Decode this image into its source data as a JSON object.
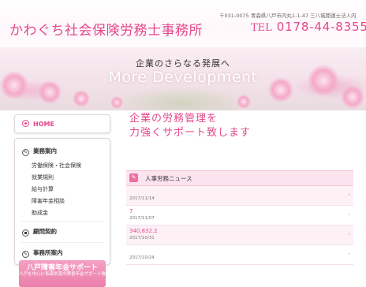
{
  "header": {
    "title": "かわぐち社会保険労務士事務所",
    "address": "〒031-0075 青森県八戸市内丸1-1-47 三八城開運士法人内",
    "tel_label": "TEL",
    "tel_number": "0178-44-8355"
  },
  "hero": {
    "tagline": "企業のさらなる発展へ",
    "english": "More Development"
  },
  "sidebar": {
    "home": "HOME",
    "groups": [
      {
        "icon": "pencil-icon",
        "label": "業務案内",
        "items": [
          "労働保険・社会保険",
          "就業規則",
          "給与計算",
          "障害年金相談",
          "助成金"
        ]
      },
      {
        "icon": "doc-icon",
        "label": "顧問契約",
        "items": []
      },
      {
        "icon": "pencil-icon",
        "label": "事務所案内",
        "items": []
      }
    ],
    "banner": {
      "title": "八戸障害年金サポート",
      "subtitle": "八戸を中心に青森県南の障害年金サポート致します"
    }
  },
  "main": {
    "heading_line1": "企業の労務管理を",
    "heading_line2": "力強くサポート致します"
  },
  "news": {
    "title": "人事労務ニュース",
    "items": [
      {
        "text": "",
        "date": "2017/11/14"
      },
      {
        "text": "7",
        "date": "2017/11/07"
      },
      {
        "text": "340,832.2",
        "date": "2017/10/31"
      },
      {
        "text": "",
        "date": "2017/10/24"
      }
    ]
  },
  "colors": {
    "accent": "#e4488a",
    "news_header": "#fce3ee",
    "banner": "#ef8cb3"
  }
}
